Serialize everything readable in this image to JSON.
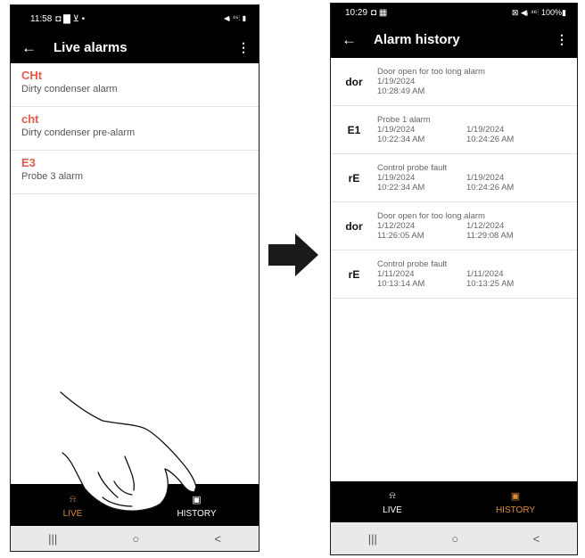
{
  "left": {
    "status": {
      "time": "11:58",
      "icons": "◘ ▇ ⊻ •",
      "right": "◀ᵢ ⁴⁶⫶ ▮"
    },
    "title": "Live alarms",
    "alarms": [
      {
        "code": "CHt",
        "desc": "Dirty condenser alarm"
      },
      {
        "code": "cht",
        "desc": "Dirty condenser pre-alarm"
      },
      {
        "code": "E3",
        "desc": "Probe 3 alarm"
      }
    ],
    "nav": [
      {
        "icon": "alarm-icon",
        "label": "LIVE",
        "color": "#d98a3a"
      },
      {
        "icon": "history-icon",
        "label": "HISTORY",
        "color": "#ffffff"
      }
    ]
  },
  "right": {
    "status": {
      "time": "10:29",
      "icons": "◘ ▦",
      "right": "⊠ ◀ᵢ ⁴⁶⫶ 100%▮"
    },
    "title": "Alarm history",
    "history": [
      {
        "code": "dor",
        "desc": "Door open for too long alarm",
        "start_date": "1/19/2024",
        "start_time": "10:28:49 AM",
        "end_date": "",
        "end_time": ""
      },
      {
        "code": "E1",
        "desc": "Probe 1 alarm",
        "start_date": "1/19/2024",
        "start_time": "10:22:34 AM",
        "end_date": "1/19/2024",
        "end_time": "10:24:26 AM"
      },
      {
        "code": "rE",
        "desc": "Control probe fault",
        "start_date": "1/19/2024",
        "start_time": "10:22:34 AM",
        "end_date": "1/19/2024",
        "end_time": "10:24:26 AM"
      },
      {
        "code": "dor",
        "desc": "Door open for too long alarm",
        "start_date": "1/12/2024",
        "start_time": "11:26:05 AM",
        "end_date": "1/12/2024",
        "end_time": "11:29:08 AM"
      },
      {
        "code": "rE",
        "desc": "Control probe fault",
        "start_date": "1/11/2024",
        "start_time": "10:13:14 AM",
        "end_date": "1/11/2024",
        "end_time": "10:13:25 AM"
      }
    ],
    "nav": [
      {
        "icon": "alarm-icon",
        "label": "LIVE",
        "color": "#ffffff"
      },
      {
        "icon": "history-icon",
        "label": "HISTORY",
        "color": "#d98a3a"
      }
    ]
  },
  "sysnav": {
    "recents": "|||",
    "home": "○",
    "back": "<"
  }
}
